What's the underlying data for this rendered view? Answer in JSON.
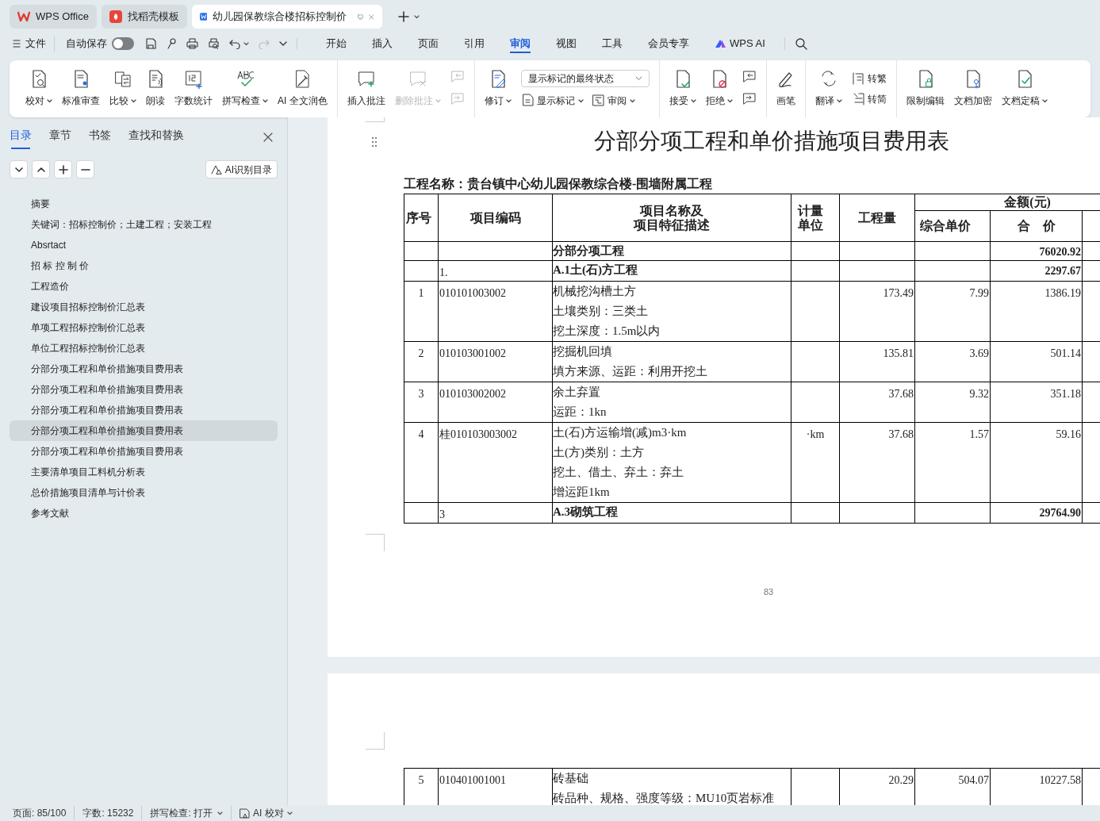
{
  "window_tabs": [
    {
      "kind": "home",
      "label": "WPS Office",
      "selected": false
    },
    {
      "kind": "template",
      "label": "找稻壳模板",
      "selected": false
    },
    {
      "kind": "doc",
      "label": "幼儿园保教综合楼招标控制价",
      "selected": true
    }
  ],
  "quick_bar": {
    "file_label": "文件",
    "autosave_label": "自动保存",
    "autosave_on": false
  },
  "menu": [
    {
      "label": "开始",
      "selected": false
    },
    {
      "label": "插入",
      "selected": false
    },
    {
      "label": "页面",
      "selected": false
    },
    {
      "label": "引用",
      "selected": false
    },
    {
      "label": "审阅",
      "selected": true
    },
    {
      "label": "视图",
      "selected": false
    },
    {
      "label": "工具",
      "selected": false
    },
    {
      "label": "会员专享",
      "selected": false
    },
    {
      "label": "WPS AI",
      "selected": false
    }
  ],
  "ribbon": [
    {
      "items": [
        {
          "kind": "large",
          "label": "校对",
          "caret": true,
          "disabled": false
        },
        {
          "kind": "large",
          "label": "标准审查",
          "caret": false,
          "disabled": false
        },
        {
          "kind": "large",
          "label": "比较",
          "caret": true,
          "disabled": false
        },
        {
          "kind": "large",
          "label": "朗读",
          "caret": false,
          "disabled": false
        },
        {
          "kind": "large",
          "label": "字数统计",
          "caret": false,
          "disabled": false
        },
        {
          "kind": "large",
          "label": "拼写检查",
          "caret": true,
          "disabled": false
        },
        {
          "kind": "large",
          "label": "AI 全文润色",
          "caret": false,
          "disabled": false
        }
      ]
    },
    {
      "items": [
        {
          "kind": "large",
          "label": "插入批注",
          "caret": false,
          "disabled": false
        },
        {
          "kind": "large",
          "label": "删除批注",
          "caret": true,
          "disabled": true
        },
        {
          "kind": "stack",
          "items": [
            {
              "kind": "icon",
              "disabled": true
            },
            {
              "kind": "icon",
              "disabled": true
            }
          ]
        }
      ]
    },
    {
      "items": [
        {
          "kind": "large",
          "label": "修订",
          "caret": true,
          "disabled": false
        },
        {
          "kind": "stack",
          "items": [
            {
              "kind": "select",
              "label": "显示标记的最终状态"
            },
            {
              "kind": "pair",
              "items": [
                {
                  "kind": "small",
                  "label": "显示标记",
                  "caret": true,
                  "disabled": false
                },
                {
                  "kind": "small",
                  "label": "审阅",
                  "caret": true,
                  "disabled": false
                }
              ]
            }
          ]
        }
      ]
    },
    {
      "items": [
        {
          "kind": "large",
          "label": "接受",
          "caret": true,
          "disabled": false
        },
        {
          "kind": "large",
          "label": "拒绝",
          "caret": true,
          "disabled": false
        },
        {
          "kind": "stack",
          "items": [
            {
              "kind": "icon",
              "disabled": false
            },
            {
              "kind": "icon",
              "disabled": false
            }
          ]
        }
      ]
    },
    {
      "items": [
        {
          "kind": "large",
          "label": "画笔",
          "caret": false,
          "disabled": false
        }
      ]
    },
    {
      "items": [
        {
          "kind": "large",
          "label": "翻译",
          "caret": true,
          "disabled": false
        },
        {
          "kind": "stack",
          "items": [
            {
              "kind": "small",
              "label": "转繁",
              "caret": false,
              "disabled": false
            },
            {
              "kind": "small",
              "label": "转简",
              "caret": false,
              "disabled": false
            }
          ]
        }
      ]
    },
    {
      "items": [
        {
          "kind": "large",
          "label": "限制编辑",
          "caret": false,
          "disabled": false
        },
        {
          "kind": "large",
          "label": "文档加密",
          "caret": false,
          "disabled": false
        },
        {
          "kind": "large",
          "label": "文档定稿",
          "caret": true,
          "disabled": false
        }
      ]
    }
  ],
  "nav_panel": {
    "tabs": [
      {
        "label": "目录",
        "selected": true
      },
      {
        "label": "章节",
        "selected": false
      },
      {
        "label": "书签",
        "selected": false
      },
      {
        "label": "查找和替换",
        "selected": false
      }
    ],
    "ai_button": "AI识别目录",
    "items": [
      {
        "label": "摘要",
        "selected": false
      },
      {
        "label": "关键词：招标控制价；土建工程；安装工程",
        "selected": false
      },
      {
        "label": "Absrtact",
        "selected": false
      },
      {
        "label": "招 标 控 制 价",
        "selected": false
      },
      {
        "label": "工程造价",
        "selected": false
      },
      {
        "label": "建设项目招标控制价汇总表",
        "selected": false
      },
      {
        "label": "单项工程招标控制价汇总表",
        "selected": false
      },
      {
        "label": "单位工程招标控制价汇总表",
        "selected": false
      },
      {
        "label": "分部分项工程和单价措施项目费用表",
        "selected": false
      },
      {
        "label": "分部分项工程和单价措施项目费用表",
        "selected": false
      },
      {
        "label": "分部分项工程和单价措施项目费用表",
        "selected": false
      },
      {
        "label": "分部分项工程和单价措施项目费用表",
        "selected": true
      },
      {
        "label": "分部分项工程和单价措施项目费用表",
        "selected": false
      },
      {
        "label": "主要清单项目工料机分析表",
        "selected": false
      },
      {
        "label": "总价措施项目清单与计价表",
        "selected": false
      },
      {
        "label": "参考文献",
        "selected": false
      }
    ]
  },
  "document": {
    "title": "分部分项工程和单价措施项目费用表",
    "project_line": "工程名称：贵台镇中心幼儿园保教综合楼-围墙附属工程",
    "columns": {
      "no": "序号",
      "code": "项目编码",
      "name": [
        "项目名称及",
        "项目特征描述"
      ],
      "unit": [
        "计量",
        "单位"
      ],
      "qty": "工程量",
      "amount": "金额(元)",
      "price": "综合单价",
      "total": "合　价"
    },
    "rows": [
      {
        "kind": "section",
        "no": "",
        "code": "",
        "lines": [
          "分部分项工程"
        ],
        "unit": "",
        "qty": "",
        "price": "",
        "total": "76020.92"
      },
      {
        "kind": "section",
        "no": "",
        "code": "1.",
        "lines": [
          "A.1土(石)方工程"
        ],
        "unit": "",
        "qty": "",
        "price": "",
        "total": "2297.67"
      },
      {
        "kind": "item",
        "no": "1",
        "code": "010101003002",
        "lines": [
          "机械挖沟槽土方",
          "土壤类别：三类土",
          "挖土深度：1.5m以内"
        ],
        "unit": "",
        "qty": "173.49",
        "price": "7.99",
        "total": "1386.19"
      },
      {
        "kind": "item",
        "no": "2",
        "code": "010103001002",
        "lines": [
          "挖掘机回填",
          "填方来源、运距：利用开挖土"
        ],
        "unit": "",
        "qty": "135.81",
        "price": "3.69",
        "total": "501.14"
      },
      {
        "kind": "item",
        "no": "3",
        "code": "010103002002",
        "lines": [
          "余土弃置",
          "运距：1kn"
        ],
        "unit": "",
        "qty": "37.68",
        "price": "9.32",
        "total": "351.18"
      },
      {
        "kind": "item",
        "no": "4",
        "code": "桂010103003002",
        "lines": [
          "土(石)方运输增(减)m3·km",
          "土(方)类别：土方",
          "挖土、借土、弃土：弃土",
          "增运距1km"
        ],
        "unit": "·km",
        "qty": "37.68",
        "price": "1.57",
        "total": "59.16"
      },
      {
        "kind": "section",
        "no": "",
        "code": "3",
        "lines": [
          "A.3砌筑工程"
        ],
        "unit": "",
        "qty": "",
        "price": "",
        "total": "29764.90"
      }
    ],
    "page_number": "83",
    "next_page_rows": [
      {
        "kind": "item",
        "no": "5",
        "code": "010401001001",
        "lines": [
          "砖基础",
          "砖品种、规格、强度等级：MU10页岩标准"
        ],
        "unit": "",
        "qty": "20.29",
        "price": "504.07",
        "total": "10227.58"
      }
    ]
  },
  "status_bar": {
    "page": "页面: 85/100",
    "words": "字数: 15232",
    "spell": "拼写检查: 打开",
    "ai": "AI 校对"
  }
}
